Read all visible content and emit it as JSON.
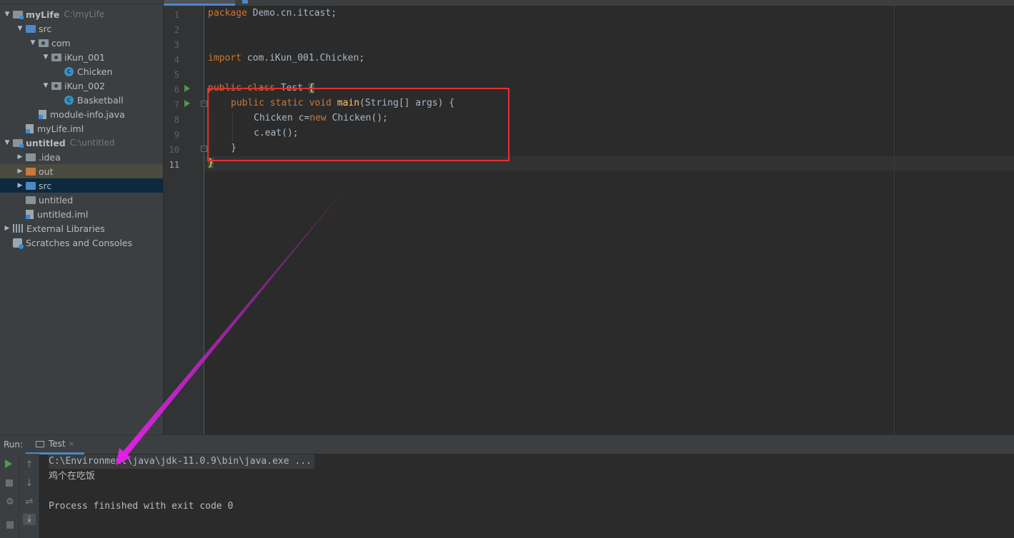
{
  "project_tree": [
    {
      "label": "myLife",
      "path": "C:\\myLife",
      "icon": "module",
      "arrow": "down",
      "bold": true
    },
    {
      "label": "src",
      "icon": "src",
      "arrow": "down"
    },
    {
      "label": "com",
      "icon": "pkg",
      "arrow": "down"
    },
    {
      "label": "iKun_001",
      "icon": "pkg",
      "arrow": "down"
    },
    {
      "label": "Chicken",
      "icon": "class"
    },
    {
      "label": "iKun_002",
      "icon": "pkg",
      "arrow": "down"
    },
    {
      "label": "Basketball",
      "icon": "class"
    },
    {
      "label": "module-info.java",
      "icon": "file"
    },
    {
      "label": "myLife.iml",
      "icon": "file"
    },
    {
      "label": "untitled",
      "path": "C:\\untitled",
      "icon": "module",
      "arrow": "down",
      "bold": true
    },
    {
      "label": ".idea",
      "icon": "folder",
      "arrow": "right"
    },
    {
      "label": "out",
      "icon": "out",
      "arrow": "right",
      "state": "out"
    },
    {
      "label": "src",
      "icon": "src",
      "arrow": "right",
      "state": "selected"
    },
    {
      "label": "untitled",
      "icon": "folder"
    },
    {
      "label": "untitled.iml",
      "icon": "file"
    },
    {
      "label": "External Libraries",
      "icon": "library",
      "arrow": "right"
    },
    {
      "label": "Scratches and Consoles",
      "icon": "scratch"
    }
  ],
  "editor": {
    "line_numbers": [
      "1",
      "2",
      "3",
      "4",
      "5",
      "6",
      "7",
      "8",
      "9",
      "10",
      "11"
    ],
    "current_line": "11",
    "code": {
      "l1_kw": "package",
      "l1_rest": " Demo.cn.itcast;",
      "l4_kw": "import",
      "l4_rest": " com.iKun_001.Chicken;",
      "l6_kw": "public class",
      "l6_name": " Test ",
      "l6_brace": "{",
      "l7_kw": "public static void",
      "l7_fn": "main",
      "l7_rest": "(String[] args) {",
      "l8_a": "Chicken c=",
      "l8_kw": "new",
      "l8_b": " Chicken();",
      "l9": "c.eat();",
      "l10": "}",
      "l11": "}"
    }
  },
  "run_panel": {
    "label": "Run:",
    "tab_label": "Test",
    "tab_close": "×",
    "console": {
      "command": "C:\\Environment\\java\\jdk-11.0.9\\bin\\java.exe ...",
      "output": "鸡个在吃饭",
      "exit": "Process finished with exit code 0"
    }
  },
  "colors": {
    "annotation_box": "#e5302f",
    "annotation_arrow": "#e020e8",
    "accent": "#4a88c7"
  }
}
